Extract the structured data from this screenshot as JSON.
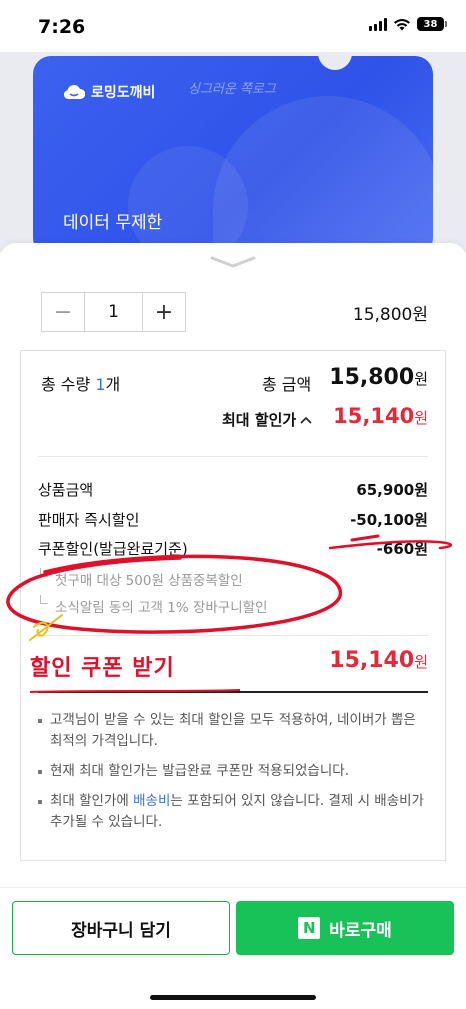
{
  "status": {
    "time": "7:26",
    "battery": "38",
    "icons": [
      "signal-icon",
      "wifi-icon",
      "battery-icon"
    ]
  },
  "banner": {
    "brand": "로밍도깨비",
    "subtitle": "싱그러운 쪽로그",
    "title": "데이터 무제한",
    "colors": {
      "background": "#3c62f0"
    }
  },
  "item": {
    "quantity": "1",
    "decrement": "−",
    "increment": "+",
    "price": "15,800",
    "price_unit": "원"
  },
  "summary": {
    "qty_label": "총 수량 ",
    "qty_num": "1",
    "qty_unit": "개",
    "total_label": "총 금액",
    "total_value": "15,800",
    "total_unit": "원",
    "max_label": "최대 할인가",
    "max_value": "15,140",
    "max_unit": "원"
  },
  "breakdown": {
    "rows": [
      {
        "label": "상품금액",
        "value": "65,900원"
      },
      {
        "label": "판매자 즉시할인",
        "value": "-50,100원"
      },
      {
        "label": "쿠폰할인(발급완료기준)",
        "value": "-660원"
      }
    ],
    "sub_rows": [
      "첫구매 대상 500원 상품중복할인",
      "소식알림 동의 고객 1% 장바구니할인"
    ]
  },
  "final": {
    "value": "15,140",
    "unit": "원"
  },
  "annotation": {
    "text": "할인 쿠폰 받기",
    "color": "#e0102a"
  },
  "notes": {
    "n1": "고객님이 받을 수 있는 최대 할인을 모두 적용하여, 네이버가 뽑은 최적의 가격입니다.",
    "n2": "현재 최대 할인가는 발급완료 쿠폰만 적용되었습니다.",
    "n3_a": "최대 할인가에 ",
    "n3_hl": "배송비",
    "n3_b": "는 포함되어 있지 않습니다. 결제 시 배송비가 추가될 수 있습니다."
  },
  "actions": {
    "cart": "장바구니 담기",
    "buy": "바로구매",
    "naver_letter": "N"
  },
  "colors": {
    "accent_red": "#e5283a",
    "accent_blue": "#3b73d9",
    "naver_green": "#19c258"
  }
}
